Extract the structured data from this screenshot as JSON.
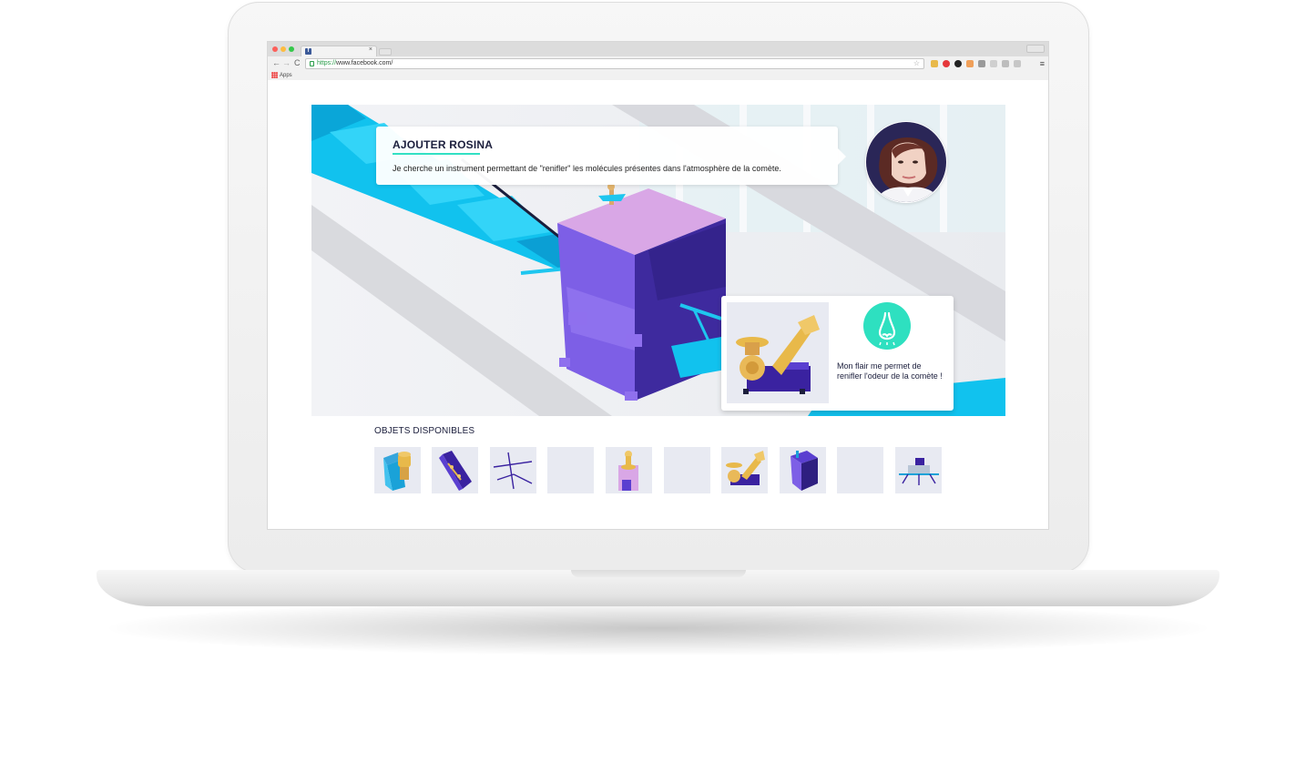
{
  "browser": {
    "tab_close": "×",
    "url_scheme": "https://",
    "url_rest": "www.facebook.com/",
    "bookmarks_apps": "Apps",
    "nav_back": "←",
    "nav_forward": "→",
    "nav_reload": "C",
    "star": "☆",
    "menu": "≡"
  },
  "dialog": {
    "title": "AJOUTER ROSINA",
    "text": "Je cherche un instrument permettant de \"renifler\" les molécules présentes dans l'atmosphère de la comète."
  },
  "info": {
    "text": "Mon flair me permet de renifler l'odeur de la comète !"
  },
  "objects": {
    "title": "OBJETS DISPONIBLES",
    "items": [
      {
        "icon": "cyan-instrument-icon",
        "filled": true
      },
      {
        "icon": "purple-panel-icon",
        "filled": true
      },
      {
        "icon": "antenna-icon",
        "filled": true
      },
      {
        "icon": "empty-slot",
        "filled": false
      },
      {
        "icon": "pink-instrument-icon",
        "filled": true
      },
      {
        "icon": "empty-slot",
        "filled": false
      },
      {
        "icon": "gold-sensor-icon",
        "filled": true
      },
      {
        "icon": "purple-box-icon",
        "filled": true
      },
      {
        "icon": "empty-slot",
        "filled": false
      },
      {
        "icon": "lander-icon",
        "filled": true
      }
    ]
  },
  "colors": {
    "accent": "#32e0c4",
    "text_dark": "#1b1e3c",
    "solar_panel": "#12c4ef",
    "module_purple": "#5a3fd0",
    "module_pink": "#d9a7e6"
  }
}
